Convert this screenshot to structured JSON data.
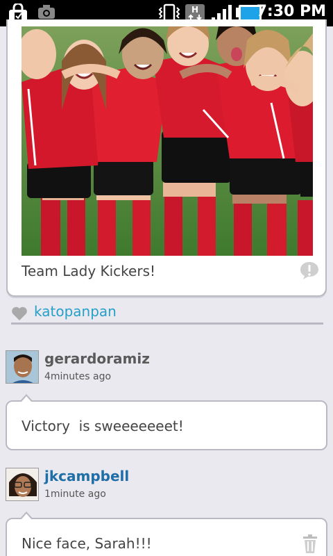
{
  "status_bar": {
    "time": "7:30 PM",
    "icons": [
      "lock-bag-icon",
      "camera-icon",
      "vibrate-icon",
      "data-transfer-icon",
      "signal-icon",
      "battery-icon"
    ]
  },
  "post": {
    "caption": "Team Lady Kickers!",
    "photo_description_icon": "team-photo"
  },
  "likes": {
    "users": "katopanpan"
  },
  "comments": [
    {
      "username": "gerardoramiz",
      "time": "4minutes ago",
      "text": "Victory  is sweeeeeeet!",
      "username_color": "#5a5a5a"
    },
    {
      "username": "jkcampbell",
      "time": "1minute ago",
      "text": "Nice face, Sarah!!!",
      "username_color": "#1f6ea8"
    }
  ],
  "colors": {
    "background": "#e9e9ef",
    "link": "#27a0c9",
    "card_border": "#b9b9c4"
  }
}
